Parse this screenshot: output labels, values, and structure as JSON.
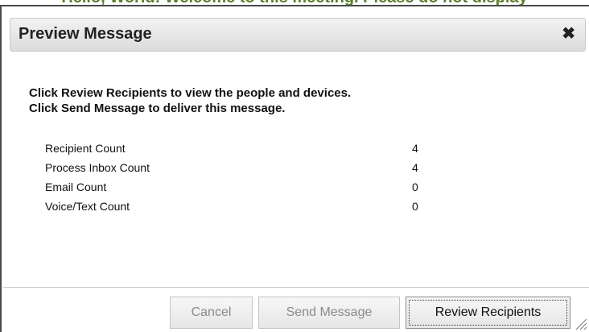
{
  "background": {
    "clipped_text": "Hello, World! Welcome to this meeting. Please do not display"
  },
  "dialog": {
    "title": "Preview Message",
    "close_glyph": "✖",
    "instructions": [
      "Click Review Recipients to view the people and devices.",
      "Click Send Message to deliver this message."
    ],
    "stats": [
      {
        "label": "Recipient Count",
        "value": "4"
      },
      {
        "label": "Process Inbox Count",
        "value": "4"
      },
      {
        "label": "Email Count",
        "value": "0"
      },
      {
        "label": "Voice/Text Count",
        "value": "0"
      }
    ],
    "buttons": {
      "cancel": "Cancel",
      "send": "Send Message",
      "review": "Review Recipients"
    }
  },
  "colors": {
    "background_text": "#5a7d2a",
    "title_text": "#222222",
    "disabled_button_text": "#8a8a8a",
    "active_button_text": "#111111"
  },
  "icons": {
    "close": "close-icon",
    "resize": "resize-grip-icon"
  }
}
